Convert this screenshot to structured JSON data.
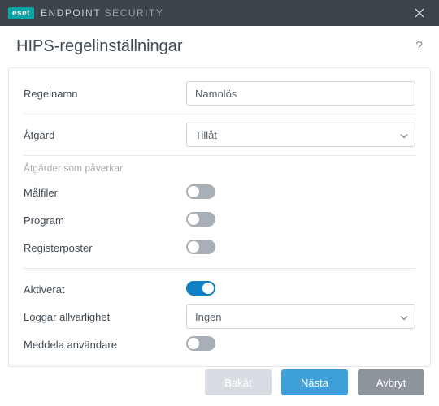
{
  "titlebar": {
    "brand_badge": "eset",
    "brand_main": "ENDPOINT",
    "brand_sub": "SECURITY"
  },
  "header": {
    "title": "HIPS-regelinställningar"
  },
  "fields": {
    "rule_name_label": "Regelnamn",
    "rule_name_value": "Namnlös",
    "action_label": "Åtgärd",
    "action_value": "Tillåt",
    "section_affects": "Åtgärder som påverkar",
    "target_files_label": "Målfiler",
    "programs_label": "Program",
    "registry_label": "Registerposter",
    "enabled_label": "Aktiverat",
    "log_severity_label": "Loggar allvarlighet",
    "log_severity_value": "Ingen",
    "notify_user_label": "Meddela användare"
  },
  "toggles": {
    "target_files": false,
    "programs": false,
    "registry": false,
    "enabled": true,
    "notify_user": false
  },
  "footer": {
    "back": "Bakåt",
    "next": "Nästa",
    "cancel": "Avbryt"
  }
}
